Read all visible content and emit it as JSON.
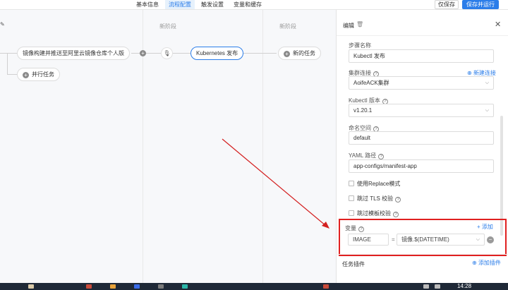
{
  "nav": {
    "tabs": [
      "基本信息",
      "流程配置",
      "触发设置",
      "变量和缓存"
    ],
    "active_tab": 1,
    "save_label": "仅保存",
    "save_run_label": "保存并运行",
    "accent_color": "#2b7de9"
  },
  "canvas": {
    "stage_new_1": "新阶段",
    "stage_new_2": "新阶段",
    "task_build": "镜像构建并推送至阿里云镜像仓库个人版",
    "parallel_task": "并行任务",
    "task_k8s": "Kubernetes 发布",
    "new_task": "新的任务"
  },
  "panel": {
    "title": "编辑",
    "step_name_label": "步骤名称",
    "step_name_value": "Kubectl 发布",
    "cluster_label": "集群连接",
    "cluster_value": "AoifeACK集群",
    "new_connection": "新建连接",
    "kubectl_version_label": "Kubectl 版本",
    "kubectl_version_value": "v1.20.1",
    "namespace_label": "命名空间",
    "namespace_value": "default",
    "yaml_label": "YAML 路径",
    "yaml_value": "app-configs/manifest-app",
    "opt_replace": "使用Replace模式",
    "opt_skip_tls": "跳过 TLS 校验",
    "opt_skip_template": "跳过模板校验",
    "vars_label": "变量",
    "add_label": "添加",
    "var_key": "IMAGE",
    "var_eq": "=",
    "var_value": "镜像.$(DATETIME)",
    "plugins_label": "任务插件",
    "add_plugin": "添加插件",
    "highlight_color": "#e02020"
  },
  "taskbar": {
    "clock": "14:28"
  }
}
